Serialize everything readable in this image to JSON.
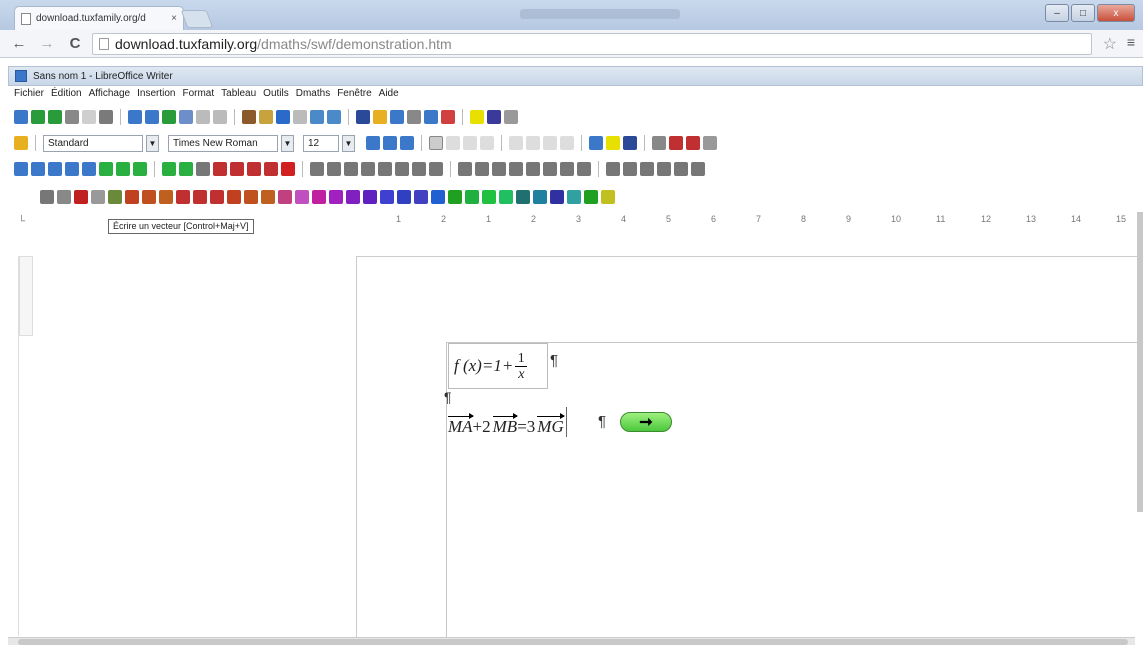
{
  "browser": {
    "tab_title": "download.tuxfamily.org/d",
    "tab_close": "×",
    "url_host": "download.tuxfamily.org",
    "url_path": "/dmaths/swf/demonstration.htm",
    "back": "←",
    "forward": "→",
    "reload": "C",
    "star": "☆",
    "menu": "≡",
    "win_min": "–",
    "win_max": "□",
    "win_close": "x"
  },
  "app": {
    "title": "Sans nom 1 - LibreOffice Writer",
    "menu": [
      "Fichier",
      "Édition",
      "Affichage",
      "Insertion",
      "Format",
      "Tableau",
      "Outils",
      "Dmaths",
      "Fenêtre",
      "Aide"
    ]
  },
  "formatting": {
    "style": "Standard",
    "font": "Times New Roman",
    "size": "12"
  },
  "toolbar_colors": {
    "tb1": [
      "#3b78c9",
      "#2a9b3a",
      "#2a9b3a",
      "#888",
      "#cfcfcf",
      "#7a7a7a",
      "#3b78c9",
      "#3b78c9",
      "#2a9b3a",
      "#6d8fc9",
      "#bbb",
      "#bbb",
      "#8a5a2a",
      "#c8a23c",
      "#2a6ac9",
      "#bbb",
      "#4a8ac9",
      "#4a8ac9",
      "#2a4a99",
      "#e8b020",
      "#3b78c9",
      "#888",
      "#3b78c9",
      "#d04040",
      "#e8e000",
      "#3a3a9a",
      "#999"
    ],
    "tb3": [
      "#3b78c9",
      "#3b78c9",
      "#3b78c9",
      "#3b78c9",
      "#3b78c9",
      "#2ab040",
      "#2ab040",
      "#2ab040",
      "#2ab040",
      "#2ab040",
      "#777",
      "#c03030",
      "#c03030",
      "#c03030",
      "#c03030",
      "#d02020",
      "#777",
      "#777",
      "#777",
      "#777",
      "#777",
      "#777",
      "#777",
      "#777",
      "#777",
      "#777",
      "#777",
      "#777",
      "#777",
      "#777",
      "#777",
      "#777",
      "#777",
      "#777",
      "#777",
      "#777",
      "#777",
      "#777"
    ],
    "tb4": [
      "#777",
      "#888",
      "#c02020",
      "#999",
      "#6a8a3a",
      "#c04020",
      "#c05020",
      "#c06020",
      "#c03030",
      "#c03030",
      "#c03030",
      "#c04020",
      "#c05020",
      "#c06020",
      "#c04080",
      "#c050c0",
      "#c020a0",
      "#a020c0",
      "#8020c0",
      "#6020c0",
      "#4040d0",
      "#3040c0",
      "#4040c0",
      "#2060d0",
      "#20a020",
      "#20b040",
      "#20c040",
      "#20c060",
      "#207070",
      "#2080a0",
      "#3030a0",
      "#30a0a0",
      "#20a020",
      "#c0c020"
    ]
  },
  "tooltip": "Écrire un vecteur [Control+Maj+V]",
  "ruler_h": [
    "1",
    "2",
    "1",
    "2",
    "3",
    "4",
    "5",
    "6",
    "7",
    "8",
    "9",
    "10",
    "11",
    "12",
    "13",
    "14",
    "15"
  ],
  "document": {
    "f1_left": "f (x)=1+",
    "f1_num": "1",
    "f1_den": "x",
    "pilcrow": "¶",
    "f2_ma": "MA",
    "f2_plus": "+2",
    "f2_mb": "MB",
    "f2_eq": "=3",
    "f2_mg": "MG",
    "arrow_btn": "➞"
  }
}
